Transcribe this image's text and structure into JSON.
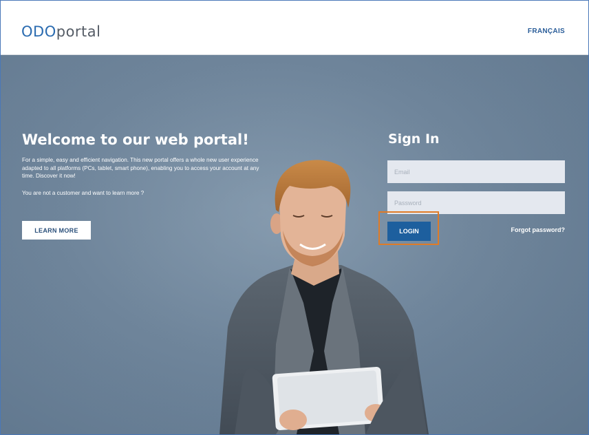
{
  "header": {
    "logo_part1": "ODO",
    "logo_part2": "portal",
    "language_link": "FRANÇAIS"
  },
  "welcome": {
    "title": "Welcome to our web portal!",
    "description": "For a simple, easy and efficient navigation. This new portal offers a whole new user experience adapted to all platforms (PCs, tablet, smart phone), enabling you to access your account at any time. Discover it now!",
    "subtext": "You are not a customer and want to learn more ?",
    "learn_more_label": "LEARN MORE"
  },
  "signin": {
    "title": "Sign In",
    "email_placeholder": "Email",
    "email_value": "",
    "password_placeholder": "Password",
    "password_value": "",
    "login_label": "LOGIN",
    "forgot_label": "Forgot password?"
  },
  "colors": {
    "brand_blue": "#2a6bb0",
    "login_button": "#1d5f9e",
    "highlight": "#e07b26",
    "hero_background": "#6f859b"
  }
}
